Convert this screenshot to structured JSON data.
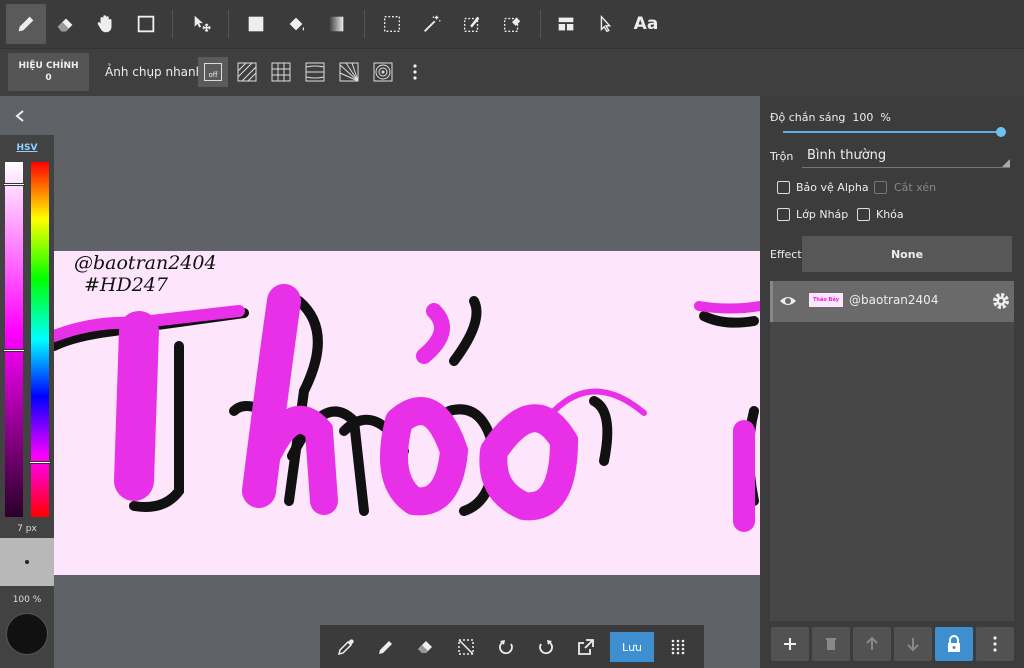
{
  "toolbar": {
    "tools": [
      "pen-tool",
      "eraser-tool",
      "hand-tool",
      "rectangle-tool",
      "transform-tool",
      "fill-color-tool",
      "bucket-tool",
      "gradient-tool",
      "select-rect-tool",
      "magic-wand-tool",
      "select-pen-tool",
      "select-eraser-tool",
      "layer-tool",
      "select-tool",
      "text-tool"
    ],
    "text_tool_label": "Aa"
  },
  "subbar": {
    "adjust_label": "HIỆU CHỈNH",
    "adjust_value": "0",
    "snapshot_label": "Ảnh chụp nhanh",
    "snap_off": "off"
  },
  "color_panel": {
    "mode": "HSV",
    "brush_size": "7 px",
    "opacity": "100 %",
    "current_color": "#111111"
  },
  "layer_props": {
    "opacity_label": "Độ chắn sáng",
    "opacity_value": "100",
    "opacity_unit": "%",
    "opacity_fraction": 1.0,
    "blend_label": "Trộn",
    "blend_value": "Bình thường",
    "protect_alpha": "Bảo vệ Alpha",
    "clipping": "Cắt xén",
    "draft_layer": "Lớp Nháp",
    "lock": "Khóa",
    "effect_label": "Effect",
    "effect_value": "None"
  },
  "layers": [
    {
      "name": "@baotran2404",
      "thumb_text": "Thảo Bảy",
      "visible": true
    }
  ],
  "artwork": {
    "signature_line1": "@baotran2404",
    "signature_line2": "#HD247",
    "lettering": "Thảo"
  },
  "bottombar": {
    "save_label": "Lưu"
  },
  "colors": {
    "accent": "#3e8fd0",
    "canvas_bg": "#fde5fb",
    "lettering": "#e830e8"
  }
}
